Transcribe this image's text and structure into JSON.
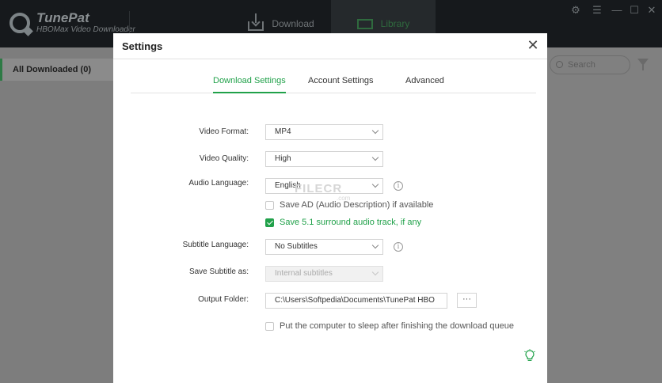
{
  "app": {
    "name": "TunePat",
    "subtitle": "HBOMax Video Downloader",
    "nav": {
      "download": "Download",
      "library": "Library"
    },
    "sidebar_item": "All Downloaded (0)",
    "search_placeholder": "Search",
    "accent_color": "#21a14a"
  },
  "dialog": {
    "title": "Settings",
    "close_symbol": "✕",
    "tabs": [
      "Download Settings",
      "Account Settings",
      "Advanced"
    ],
    "active_tab": "Download Settings",
    "video_format": {
      "label": "Video Format:",
      "value": "MP4"
    },
    "video_quality": {
      "label": "Video Quality:",
      "value": "High"
    },
    "audio_language": {
      "label": "Audio Language:",
      "value": "English"
    },
    "save_ad": {
      "label": "Save AD (Audio Description) if available",
      "checked": false
    },
    "save_51": {
      "label": "Save 5.1 surround audio track, if any",
      "checked": true
    },
    "subtitle_language": {
      "label": "Subtitle Language:",
      "value": "No Subtitles"
    },
    "save_subtitle_as": {
      "label": "Save Subtitle as:",
      "value": "Internal subtitles"
    },
    "output_folder": {
      "label": "Output Folder:",
      "value": "C:\\Users\\Softpedia\\Documents\\TunePat HBO",
      "browse_label": "···"
    },
    "sleep_option": {
      "label": "Put the computer to sleep after finishing the download queue",
      "checked": false
    },
    "info_symbol": "i"
  },
  "watermark": {
    "text": "FILECR",
    "sub": ".com"
  }
}
